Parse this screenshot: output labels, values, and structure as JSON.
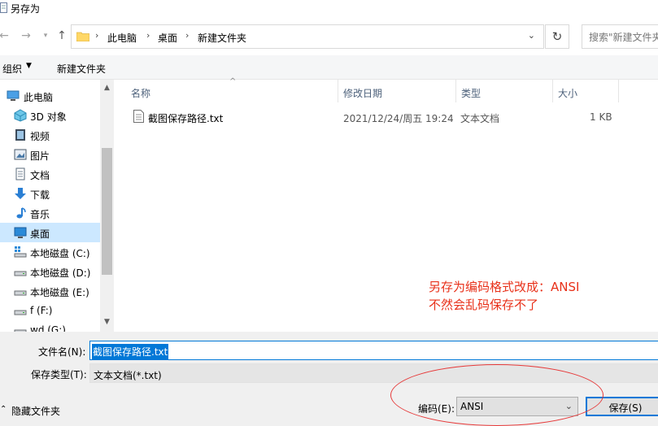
{
  "window": {
    "title": "另存为"
  },
  "nav": {
    "back_icon": "back-arrow-icon",
    "forward_icon": "forward-arrow-icon",
    "recent_icon": "chevron-down-icon",
    "up_icon": "up-arrow-icon",
    "breadcrumb": [
      "此电脑",
      "桌面",
      "新建文件夹"
    ],
    "search_placeholder": "搜索\"新建文件夹\""
  },
  "toolbar": {
    "organize_label": "组织",
    "new_folder_label": "新建文件夹"
  },
  "sidebar": {
    "items": [
      {
        "label": "此电脑",
        "icon": "computer-icon"
      },
      {
        "label": "3D 对象",
        "icon": "3d-objects-icon"
      },
      {
        "label": "视频",
        "icon": "video-icon"
      },
      {
        "label": "图片",
        "icon": "pictures-icon"
      },
      {
        "label": "文档",
        "icon": "documents-icon"
      },
      {
        "label": "下载",
        "icon": "download-icon"
      },
      {
        "label": "音乐",
        "icon": "music-icon"
      },
      {
        "label": "桌面",
        "icon": "desktop-icon",
        "selected": true
      },
      {
        "label": "本地磁盘 (C:)",
        "icon": "system-drive-icon"
      },
      {
        "label": "本地磁盘 (D:)",
        "icon": "drive-icon"
      },
      {
        "label": "本地磁盘 (E:)",
        "icon": "drive-icon"
      },
      {
        "label": "f (F:)",
        "icon": "drive-icon"
      },
      {
        "label": "wd (G:)",
        "icon": "drive-icon"
      }
    ]
  },
  "columns": {
    "name": "名称",
    "modified": "修改日期",
    "type": "类型",
    "size": "大小"
  },
  "files": [
    {
      "name": "截图保存路径.txt",
      "modified": "2021/12/24/周五 19:24",
      "type": "文本文档",
      "size": "1 KB",
      "icon": "text-file-icon"
    }
  ],
  "annotation": {
    "line1": "另存为编码格式改成：ANSI",
    "line2": "不然会乱码保存不了",
    "color": "#e8311a"
  },
  "form": {
    "filename_label": "文件名(N):",
    "filename_value": "截图保存路径.txt",
    "filetype_label": "保存类型(T):",
    "filetype_value": "文本文档(*.txt)",
    "hide_folders_label": "隐藏文件夹",
    "encoding_label": "编码(E):",
    "encoding_value": "ANSI",
    "save_label": "保存(S)"
  }
}
